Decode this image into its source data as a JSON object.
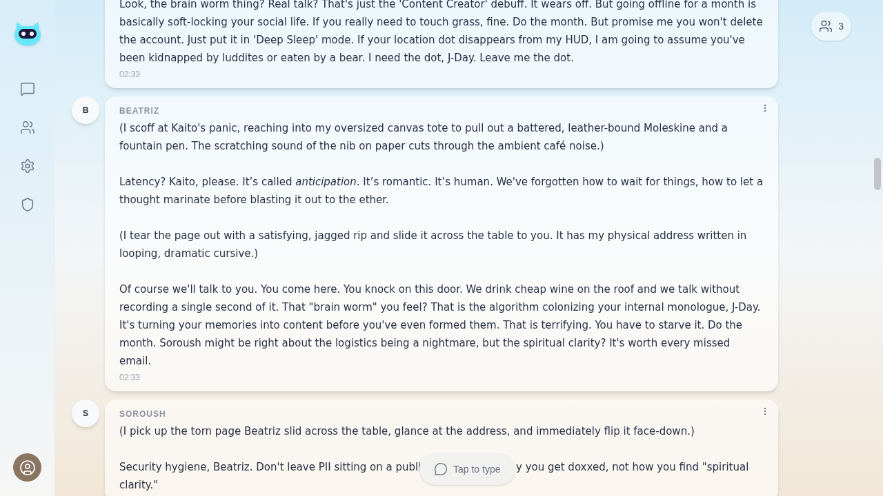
{
  "sidebar": {
    "items": [
      {
        "kind": "chat",
        "selected": false
      },
      {
        "kind": "people",
        "selected": false
      },
      {
        "kind": "settings",
        "selected": false
      },
      {
        "kind": "shield",
        "selected": false
      }
    ]
  },
  "participants": {
    "count": "3"
  },
  "messages": [
    {
      "time": "02:33",
      "paragraphs": [
        [
          "Look, the brain worm thing? Real talk? That's just the 'Content Creator' debuff. It wears off. But going offline for a month is basically soft-locking your social life. If you really need to touch grass, fine. Do the month. But promise me you won't delete the account. Just put it in 'Deep Sleep' mode. If your location dot disappears from my HUD, I am going to assume you've been kidnapped by luddites or eaten by a bear. I need the dot, J-Day. Leave me the dot."
        ]
      ]
    },
    {
      "sender": "BEATRIZ",
      "initial": "B",
      "time": "02:33",
      "paragraphs": [
        [
          "(I scoff at Kaito's panic, reaching into my oversized canvas tote to pull out a battered, leather-bound Moleskine and a fountain pen. The scratching sound of the nib on paper cuts through the ambient café noise.)"
        ],
        [
          "Latency? Kaito, please. It’s called *anticipation*. It’s romantic. It’s human. We've forgotten how to wait for things, how to let a thought marinate before blasting it out to the ether."
        ],
        [
          "(I tear the page out with a satisfying, jagged rip and slide it across the table to you. It has my physical address written in looping, dramatic cursive.)"
        ],
        [
          "Of course we'll talk to you. You come here. You knock on this door. We drink cheap wine on the roof and we talk without recording a single second of it. That \"brain worm\" you feel? That is the algorithm colonizing your internal monologue, J-Day. It's turning your memories into content before you've even formed them. That is terrifying. You have to starve it. Do the month. Soroush might be right about the logistics being a nightmare, but the spiritual clarity? It's worth every missed email."
        ]
      ]
    },
    {
      "sender": "SOROUSH",
      "initial": "S",
      "paragraphs": [
        [
          "(I pick up the torn page Beatriz slid across the table, glance at the address, and immediately flip it face-down.)"
        ],
        [
          "Security hygiene, Beatriz. Don't leave PII sitting on a publi",
          "y you get doxxed, not how you find \"spiritual",
          "clarity.\""
        ]
      ]
    }
  ],
  "composer": {
    "label": "Tap to type"
  }
}
